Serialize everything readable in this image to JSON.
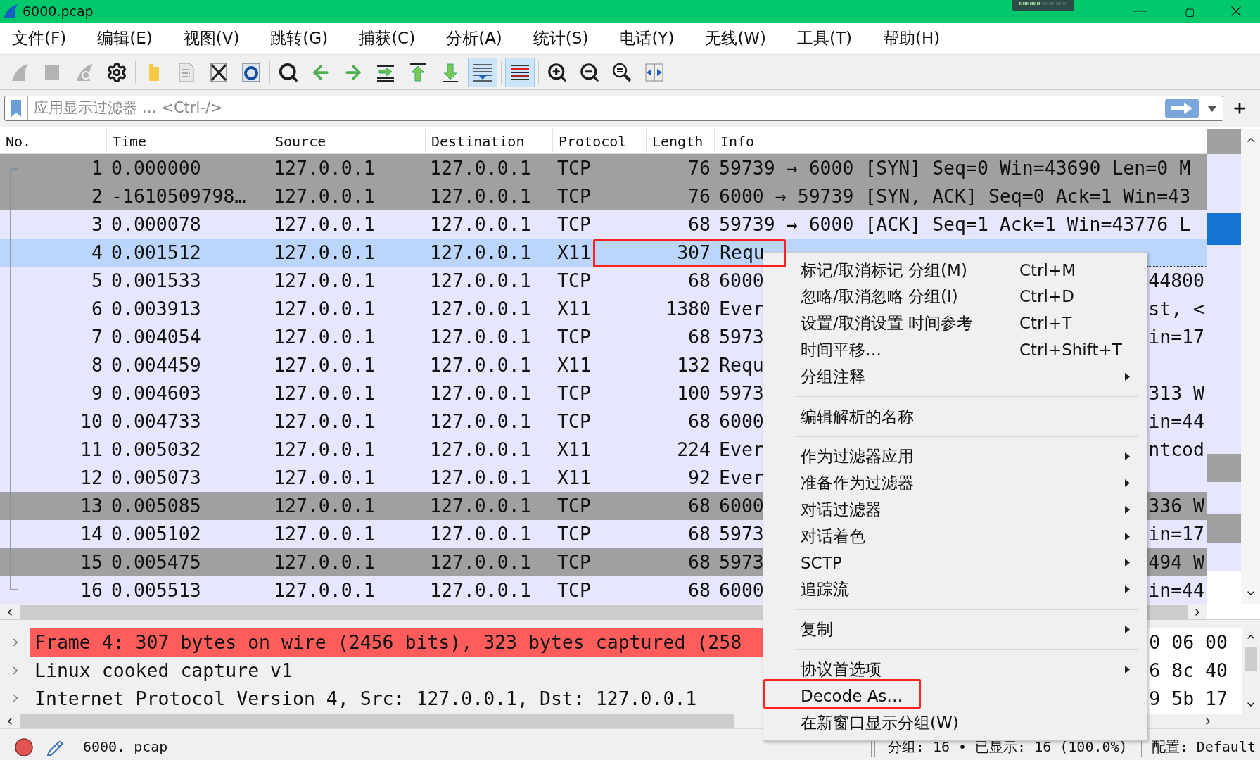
{
  "window": {
    "title": "6000.pcap"
  },
  "menu_bar": [
    "文件(F)",
    "编辑(E)",
    "视图(V)",
    "跳转(G)",
    "捕获(C)",
    "分析(A)",
    "统计(S)",
    "电话(Y)",
    "无线(W)",
    "工具(T)",
    "帮助(H)"
  ],
  "toolbar": [
    {
      "disabled": true,
      "on": false
    },
    {
      "disabled": true,
      "on": false
    },
    {
      "disabled": true,
      "on": false
    },
    {
      "disabled": false,
      "on": false
    },
    {
      "disabled": false,
      "on": false
    },
    {
      "disabled": false,
      "on": false
    },
    {
      "disabled": false,
      "on": false
    },
    {
      "disabled": false,
      "on": false
    },
    {
      "disabled": false,
      "on": false
    },
    {
      "disabled": false,
      "on": false
    },
    {
      "disabled": false,
      "on": false
    },
    {
      "disabled": false,
      "on": false
    },
    {
      "disabled": false,
      "on": false
    },
    {
      "disabled": false,
      "on": false
    },
    {
      "disabled": false,
      "on": true
    },
    {
      "disabled": false,
      "on": true
    },
    {
      "disabled": false,
      "on": false
    },
    {
      "disabled": false,
      "on": false
    },
    {
      "disabled": false,
      "on": false
    },
    {
      "disabled": false,
      "on": false
    }
  ],
  "filter_bar": {
    "placeholder": "应用显示过滤器 … <Ctrl-/>"
  },
  "packet_list": {
    "columns": [
      "No.",
      "Time",
      "Source",
      "Destination",
      "Protocol",
      "Length",
      "Info"
    ],
    "rows": [
      {
        "no": "1",
        "time": "0.000000",
        "source": "127.0.0.1",
        "destination": "127.0.0.1",
        "protocol": "TCP",
        "length": "76",
        "info": "59739 → 6000 [SYN] Seq=0 Win=43690 Len=0 M",
        "color": "#a0a0a0",
        "selected": false
      },
      {
        "no": "2",
        "time": "-1610509798…",
        "source": "127.0.0.1",
        "destination": "127.0.0.1",
        "protocol": "TCP",
        "length": "76",
        "info": "6000 → 59739 [SYN, ACK] Seq=0 Ack=1 Win=43",
        "color": "#a0a0a0",
        "selected": false
      },
      {
        "no": "3",
        "time": "0.000078",
        "source": "127.0.0.1",
        "destination": "127.0.0.1",
        "protocol": "TCP",
        "length": "68",
        "info": "59739 → 6000 [ACK] Seq=1 Ack=1 Win=43776 L",
        "color": "#e7e6ff",
        "selected": false
      },
      {
        "no": "4",
        "time": "0.001512",
        "source": "127.0.0.1",
        "destination": "127.0.0.1",
        "protocol": "X11",
        "length": "307",
        "info": "Requ",
        "selected": true
      },
      {
        "no": "5",
        "time": "0.001533",
        "source": "127.0.0.1",
        "destination": "127.0.0.1",
        "protocol": "TCP",
        "length": "68",
        "info": "6000",
        "info_end": "44800",
        "color": "#e7e6ff",
        "selected": false
      },
      {
        "no": "6",
        "time": "0.003913",
        "source": "127.0.0.1",
        "destination": "127.0.0.1",
        "protocol": "X11",
        "length": "1380",
        "info": "Ever",
        "info_end": "st, <",
        "color": "#e7e6ff",
        "selected": false
      },
      {
        "no": "7",
        "time": "0.004054",
        "source": "127.0.0.1",
        "destination": "127.0.0.1",
        "protocol": "TCP",
        "length": "68",
        "info": "5973",
        "info_end": "in=17",
        "color": "#e7e6ff",
        "selected": false
      },
      {
        "no": "8",
        "time": "0.004459",
        "source": "127.0.0.1",
        "destination": "127.0.0.1",
        "protocol": "X11",
        "length": "132",
        "info": "Requ",
        "color": "#e7e6ff",
        "selected": false
      },
      {
        "no": "9",
        "time": "0.004603",
        "source": "127.0.0.1",
        "destination": "127.0.0.1",
        "protocol": "TCP",
        "length": "100",
        "info": "5973",
        "info_end": "313 W",
        "color": "#e7e6ff",
        "selected": false
      },
      {
        "no": "10",
        "time": "0.004733",
        "source": "127.0.0.1",
        "destination": "127.0.0.1",
        "protocol": "TCP",
        "length": "68",
        "info": "6000",
        "info_end": "in=44",
        "color": "#e7e6ff",
        "selected": false
      },
      {
        "no": "11",
        "time": "0.005032",
        "source": "127.0.0.1",
        "destination": "127.0.0.1",
        "protocol": "X11",
        "length": "224",
        "info": "Ever",
        "info_end": "ntcod",
        "color": "#e7e6ff",
        "selected": false
      },
      {
        "no": "12",
        "time": "0.005073",
        "source": "127.0.0.1",
        "destination": "127.0.0.1",
        "protocol": "X11",
        "length": "92",
        "info": "Ever",
        "color": "#e7e6ff",
        "selected": false
      },
      {
        "no": "13",
        "time": "0.005085",
        "source": "127.0.0.1",
        "destination": "127.0.0.1",
        "protocol": "TCP",
        "length": "68",
        "info": "6000",
        "info_end": "336 W",
        "color": "#a0a0a0",
        "selected": false
      },
      {
        "no": "14",
        "time": "0.005102",
        "source": "127.0.0.1",
        "destination": "127.0.0.1",
        "protocol": "TCP",
        "length": "68",
        "info": "5973",
        "info_end": "in=17",
        "color": "#e7e6ff",
        "selected": false
      },
      {
        "no": "15",
        "time": "0.005475",
        "source": "127.0.0.1",
        "destination": "127.0.0.1",
        "protocol": "TCP",
        "length": "68",
        "info": "5973",
        "info_end": "494 W",
        "color": "#a0a0a0",
        "selected": false
      },
      {
        "no": "16",
        "time": "0.005513",
        "source": "127.0.0.1",
        "destination": "127.0.0.1",
        "protocol": "TCP",
        "length": "68",
        "info": "6000",
        "info_end": "in=44",
        "color": "#e7e6ff",
        "selected": false
      }
    ]
  },
  "packet_details": [
    {
      "text": "Frame 4: 307 bytes on wire (2456 bits), 323 bytes captured (258",
      "expanded": false,
      "highlighted": true
    },
    {
      "text": "Linux cooked capture v1",
      "expanded": false,
      "highlighted": false
    },
    {
      "text": "Internet Protocol Version 4, Src: 127.0.0.1, Dst: 127.0.0.1",
      "expanded": false,
      "highlighted": false
    }
  ],
  "packet_bytes": [
    "0 06 00",
    "6 8c 40",
    "9 5b 17"
  ],
  "context_menu": [
    {
      "kind": "item",
      "label": "标记/取消标记 分组(M)",
      "shortcut": "Ctrl+M",
      "submenu": false
    },
    {
      "kind": "item",
      "label": "忽略/取消忽略 分组(I)",
      "shortcut": "Ctrl+D",
      "submenu": false
    },
    {
      "kind": "item",
      "label": "设置/取消设置 时间参考",
      "shortcut": "Ctrl+T",
      "submenu": false
    },
    {
      "kind": "item",
      "label": "时间平移…",
      "shortcut": "Ctrl+Shift+T",
      "submenu": false
    },
    {
      "kind": "item",
      "label": "分组注释",
      "submenu": true
    },
    {
      "kind": "separator"
    },
    {
      "kind": "item",
      "label": "编辑解析的名称",
      "submenu": false
    },
    {
      "kind": "separator"
    },
    {
      "kind": "item",
      "label": "作为过滤器应用",
      "submenu": true
    },
    {
      "kind": "item",
      "label": "准备作为过滤器",
      "submenu": true
    },
    {
      "kind": "item",
      "label": "对话过滤器",
      "submenu": true
    },
    {
      "kind": "item",
      "label": "对话着色",
      "submenu": true
    },
    {
      "kind": "item",
      "label": "SCTP",
      "submenu": true
    },
    {
      "kind": "item",
      "label": "追踪流",
      "submenu": true
    },
    {
      "kind": "separator"
    },
    {
      "kind": "item",
      "label": "复制",
      "submenu": true
    },
    {
      "kind": "separator"
    },
    {
      "kind": "item",
      "label": "协议首选项",
      "submenu": true
    },
    {
      "kind": "item",
      "label": "Decode As…",
      "submenu": false
    },
    {
      "kind": "item",
      "label": "在新窗口显示分组(W)",
      "submenu": false
    }
  ],
  "status_bar": {
    "file": "6000. pcap",
    "packets": "分组: 16 • 已显示: 16 (100.0%)",
    "profile": "配置: Default"
  }
}
